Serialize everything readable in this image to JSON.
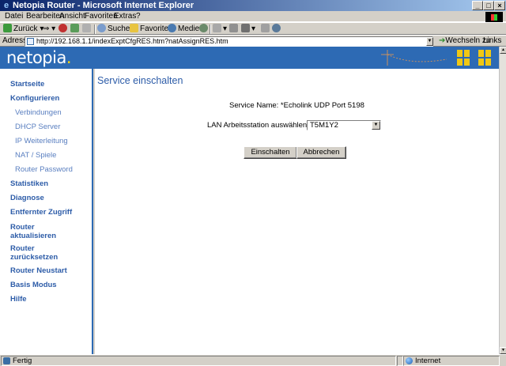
{
  "window": {
    "title": "Netopia Router - Microsoft Internet Explorer",
    "controls": [
      "_",
      "□",
      "×"
    ]
  },
  "menu": {
    "items": [
      {
        "label": "Datei"
      },
      {
        "label": "Bearbeiten"
      },
      {
        "label": "Ansicht"
      },
      {
        "label": "Favoriten"
      },
      {
        "label": "Extras"
      },
      {
        "label": "?"
      }
    ]
  },
  "toolbar": {
    "back_label": "Zurück",
    "search_label": "Suchen",
    "favorites_label": "Favoriten",
    "media_label": "Medien"
  },
  "address": {
    "label": "Adresse",
    "url": "http://192.168.1.1/indexExptCfgRES.htm?natAssignRES.htm",
    "go_label": "Wechseln zu",
    "links_label": "Links"
  },
  "banner": {
    "logo_text": "netopia",
    "logo_dot": "."
  },
  "sidebar": {
    "items": [
      {
        "label": "Startseite",
        "type": "main"
      },
      {
        "label": "Konfigurieren",
        "type": "main"
      },
      {
        "label": "Verbindungen",
        "type": "sub"
      },
      {
        "label": "DHCP Server",
        "type": "sub"
      },
      {
        "label": "IP Weiterleitung",
        "type": "sub"
      },
      {
        "label": "NAT / Spiele",
        "type": "sub"
      },
      {
        "label": "Router Password",
        "type": "sub"
      },
      {
        "label": "Statistiken",
        "type": "main"
      },
      {
        "label": "Diagnose",
        "type": "main"
      },
      {
        "label": "Entfernter Zugriff",
        "type": "main"
      },
      {
        "label": "Router",
        "label2": "aktualisieren",
        "type": "main"
      },
      {
        "label": "Router",
        "label2": "zurücksetzen",
        "type": "main"
      },
      {
        "label": "Router Neustart",
        "type": "main"
      },
      {
        "label": "Basis Modus",
        "type": "main"
      },
      {
        "label": "Hilfe",
        "type": "main"
      }
    ]
  },
  "main": {
    "heading": "Service einschalten",
    "service_name_text": "Service Name:  *Echolink UDP Port 5198",
    "lan_label": "LAN Arbeitsstation auswählen",
    "lan_selected": "T5M1Y2",
    "enable_button": "Einschalten",
    "cancel_button": "Abbrechen"
  },
  "status": {
    "text": "Fertig",
    "zone": "Internet"
  },
  "colors": {
    "brand_blue": "#2d6ab4",
    "nav_text": "#2d5ca8",
    "window_accent": "#f0c814"
  }
}
